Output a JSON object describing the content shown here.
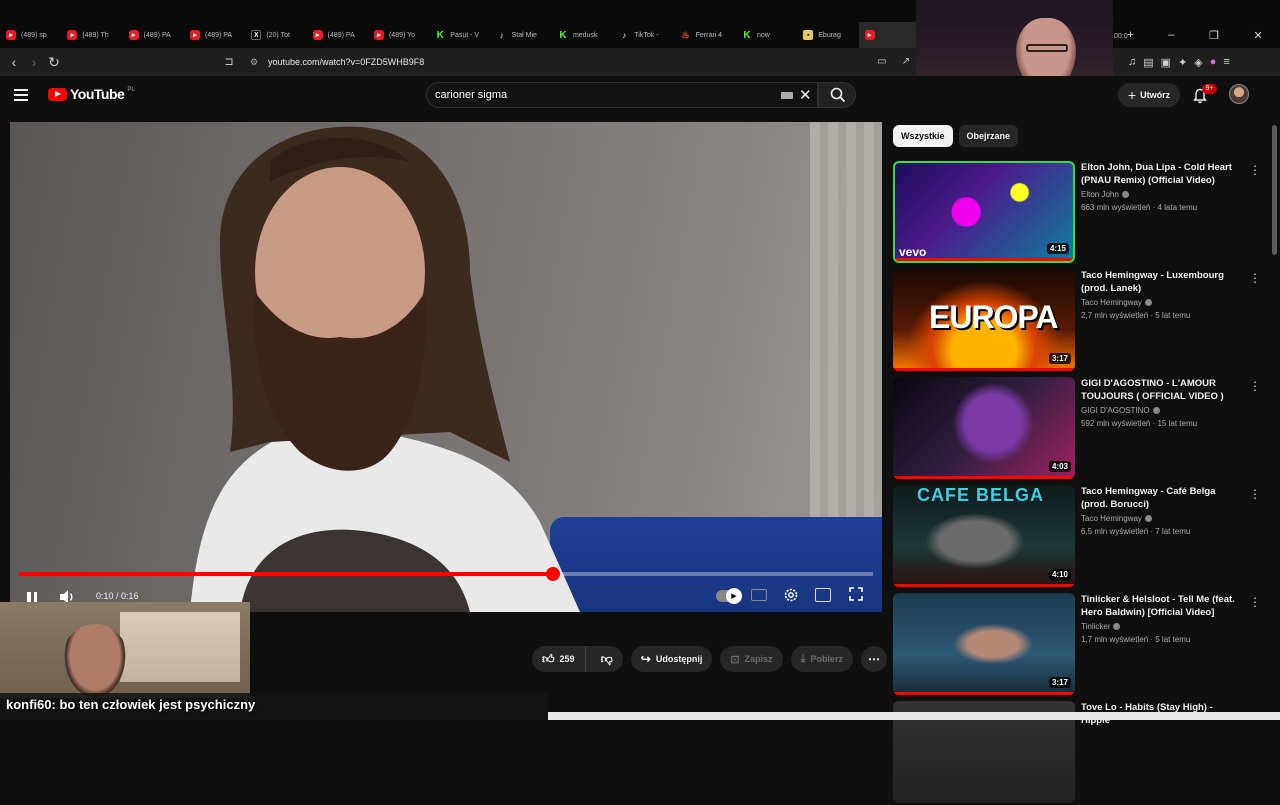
{
  "browser": {
    "tabs": [
      {
        "label": "(489) sp",
        "icon": "youtube"
      },
      {
        "label": "(489) Th",
        "icon": "youtube"
      },
      {
        "label": "(489) PA",
        "icon": "youtube"
      },
      {
        "label": "(489) PA",
        "icon": "youtube"
      },
      {
        "label": "(20) Tot",
        "icon": "x"
      },
      {
        "label": "(489) PA",
        "icon": "youtube"
      },
      {
        "label": "(489) Yo",
        "icon": "youtube"
      },
      {
        "label": "Pasut - V",
        "icon": "kick"
      },
      {
        "label": "Stał Mie",
        "icon": "tiktok"
      },
      {
        "label": "medusk",
        "icon": "kick"
      },
      {
        "label": "TikTok -",
        "icon": "tiktok"
      },
      {
        "label": "Ferrari 4",
        "icon": "fire"
      },
      {
        "label": "now",
        "icon": "kick"
      },
      {
        "label": "Eburag",
        "icon": "bag"
      },
      {
        "label": "",
        "icon": "youtube"
      }
    ],
    "url": "youtube.com/watch?v=0FZD5WHB9F8",
    "webcam_time": "00:0"
  },
  "youtube": {
    "logo_text": "YouTube",
    "logo_country": "PL",
    "search_value": "carioner sigma",
    "create_label": "Utwórz",
    "notif_count": "9+"
  },
  "player": {
    "time": "0:10 / 0:16",
    "progress": 0.625
  },
  "actions": {
    "likes": "259",
    "share": "Udostępnij",
    "save": "Zapisz",
    "download": "Pobierz"
  },
  "chat": {
    "user": "konfi60",
    "message": ": bo ten człowiek jest psychiczny"
  },
  "sidebar": {
    "chips": [
      "Wszystkie",
      "Obejrzane"
    ],
    "recommendations": [
      {
        "title": "Elton John, Dua Lipa - Cold Heart (PNAU Remix) (Official Video)",
        "channel": "Elton John",
        "meta": "663 mln wyświetleń · 4 lata temu",
        "duration": "4:15",
        "thumb_label": "vevo"
      },
      {
        "title": "Taco Hemingway - Luxembourg (prod. Lanek)",
        "channel": "Taco Hemingway",
        "meta": "2,7 mln wyświetleń · 5 lat temu",
        "duration": "3:17",
        "thumb_label": "EUROPA"
      },
      {
        "title": "GIGI D'AGOSTINO - L'AMOUR TOUJOURS ( OFFICIAL VIDEO )",
        "channel": "GIGI D'AGOSTINO",
        "meta": "592 mln wyświetleń · 15 lat temu",
        "duration": "4:03",
        "thumb_label": ""
      },
      {
        "title": "Taco Hemingway - Café Belga (prod. Borucci)",
        "channel": "Taco Hemingway",
        "meta": "6,5 mln wyświetleń · 7 lat temu",
        "duration": "4:10",
        "thumb_label": "CAFE BELGA"
      },
      {
        "title": "Tinlicker & Helsloot - Tell Me (feat. Hero Baldwin) [Official Video]",
        "channel": "Tinlicker",
        "meta": "1,7 mln wyświetleń · 5 lat temu",
        "duration": "3:17",
        "thumb_label": ""
      },
      {
        "title": "Tove Lo - Habits (Stay High) - Hippie",
        "channel": "",
        "meta": "",
        "duration": "",
        "thumb_label": ""
      }
    ]
  },
  "colors": {
    "accent": "#ff0000",
    "background": "#0f0f0f",
    "chip_bg": "#272727",
    "kick_green": "#53fc18"
  }
}
